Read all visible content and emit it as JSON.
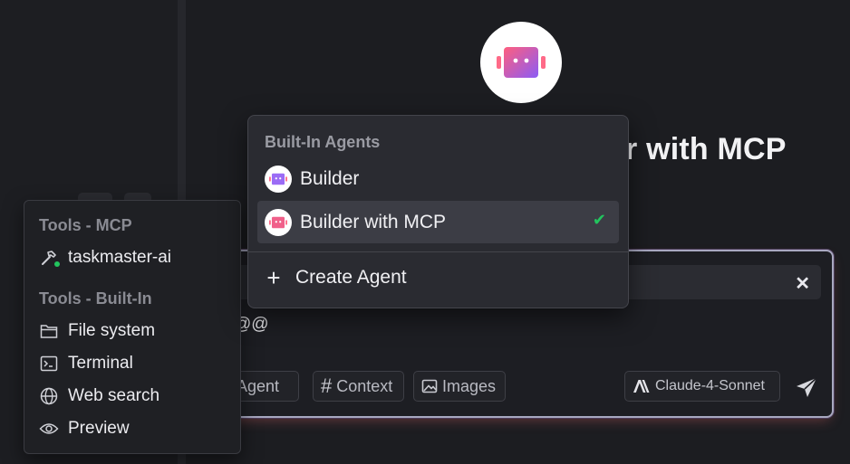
{
  "page_title": "r with MCP",
  "composer": {
    "typed_text": "@@",
    "buttons": {
      "agent": "Agent",
      "context": "Context",
      "images": "Images",
      "model": "Claude-4-Sonnet"
    }
  },
  "tools_popover": {
    "mcp_heading": "Tools - MCP",
    "mcp_items": [
      {
        "label": "taskmaster-ai",
        "icon": "hammer-icon",
        "status": "connected"
      }
    ],
    "builtin_heading": "Tools - Built-In",
    "builtin_items": [
      {
        "label": "File system",
        "icon": "folder-icon"
      },
      {
        "label": "Terminal",
        "icon": "terminal-icon"
      },
      {
        "label": "Web search",
        "icon": "globe-icon"
      },
      {
        "label": "Preview",
        "icon": "eye-icon"
      }
    ]
  },
  "agent_menu": {
    "heading": "Built-In Agents",
    "items": [
      {
        "label": "Builder",
        "selected": false
      },
      {
        "label": "Builder with MCP",
        "selected": true
      }
    ],
    "create_label": "Create Agent"
  },
  "colors": {
    "accent_green": "#22c55e",
    "robot_gradient_start": "#ff5e7e",
    "robot_gradient_end": "#8b5cf6"
  }
}
